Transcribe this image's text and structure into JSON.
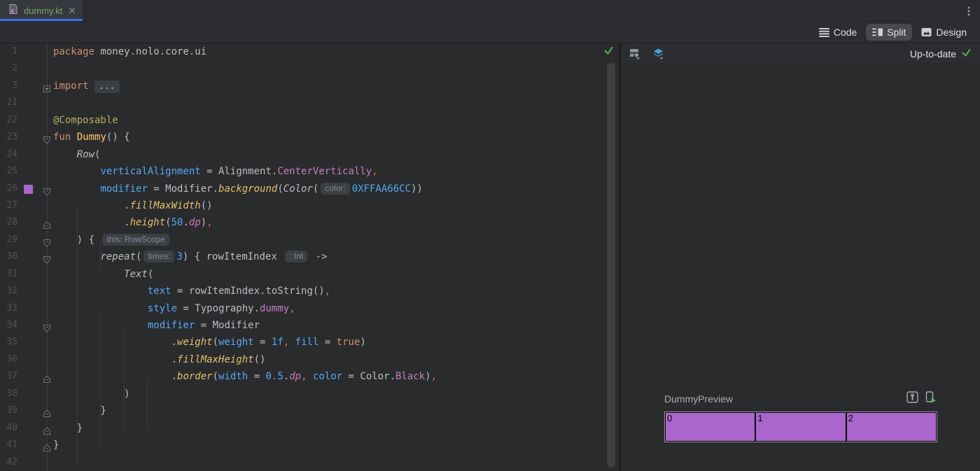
{
  "tab_bar": {
    "tab": {
      "label": "dummy.kt",
      "file_icon": "kotlin-file-icon",
      "close_icon": "close-icon",
      "active": true
    },
    "overflow_icon": "kebab-menu-icon"
  },
  "mode_toolbar": {
    "modes": [
      {
        "label": "Code",
        "icon": "code-lines-icon",
        "selected": false
      },
      {
        "label": "Split",
        "icon": "split-view-icon",
        "selected": true
      },
      {
        "label": "Design",
        "icon": "design-image-icon",
        "selected": false
      }
    ]
  },
  "editor": {
    "language": "kotlin",
    "token_colors": {
      "kw": "#CF8E6D",
      "ann": "#B3AE60",
      "decl": "#FFC66D",
      "w": "#BCBEC4",
      "calli": "#BCBEC4",
      "ext": "#E8BF6A",
      "param": "#56A8F5",
      "num": "#56A8F5",
      "prop": "#C77DBB",
      "propi": "#C77DBB",
      "comma": "#D5705C",
      "chip_text": "#868B94",
      "chip_bg": "#3C3F44",
      "foldbox_text": "#BFC2C7",
      "foldbox_bg": "#3B3E42"
    },
    "rows": [
      {
        "n": "1",
        "toks": [
          [
            "kw",
            "package"
          ],
          [
            "w",
            " money.nolo.core.ui"
          ]
        ]
      },
      {
        "n": "2",
        "toks": []
      },
      {
        "n": "3",
        "fold": "plus",
        "toks": [
          [
            "kw",
            "import"
          ],
          [
            "w",
            " "
          ],
          [
            "foldbox",
            "..."
          ]
        ]
      },
      {
        "n": "21",
        "toks": []
      },
      {
        "n": "22",
        "toks": [
          [
            "ann",
            "@Composable"
          ]
        ]
      },
      {
        "n": "23",
        "fold": "start",
        "toks": [
          [
            "kw",
            "fun"
          ],
          [
            "w",
            " "
          ],
          [
            "decl",
            "Dummy"
          ],
          [
            "w",
            "() {"
          ]
        ]
      },
      {
        "n": "24",
        "toks": [
          [
            "w",
            "    "
          ],
          [
            "calli",
            "Row"
          ],
          [
            "w",
            "("
          ]
        ]
      },
      {
        "n": "25",
        "toks": [
          [
            "w",
            "        "
          ],
          [
            "param",
            "verticalAlignment"
          ],
          [
            "w",
            " = Alignment."
          ],
          [
            "prop",
            "CenterVertically"
          ],
          [
            "comma",
            ","
          ]
        ]
      },
      {
        "n": "26",
        "fold": "start",
        "swatch": "#AA66CC",
        "toks": [
          [
            "w",
            "        "
          ],
          [
            "param",
            "modifier"
          ],
          [
            "w",
            " = Modifier."
          ],
          [
            "ext",
            "background"
          ],
          [
            "w",
            "("
          ],
          [
            "calli",
            "Color"
          ],
          [
            "w",
            "("
          ],
          [
            "chip",
            "color:"
          ],
          [
            "num",
            "0XFFAA66CC"
          ],
          [
            "w",
            "))"
          ]
        ]
      },
      {
        "n": "27",
        "toks": [
          [
            "w",
            "            ."
          ],
          [
            "ext",
            "fillMaxWidth"
          ],
          [
            "w",
            "()"
          ]
        ]
      },
      {
        "n": "28",
        "fold": "end",
        "toks": [
          [
            "w",
            "            ."
          ],
          [
            "ext",
            "height"
          ],
          [
            "w",
            "("
          ],
          [
            "num",
            "50"
          ],
          [
            "w",
            "."
          ],
          [
            "propi",
            "dp"
          ],
          [
            "w",
            ")"
          ],
          [
            "comma",
            ","
          ]
        ]
      },
      {
        "n": "29",
        "fold": "start",
        "toks": [
          [
            "w",
            "    ) { "
          ],
          [
            "chip",
            "this: RowScope"
          ]
        ]
      },
      {
        "n": "30",
        "fold": "start",
        "toks": [
          [
            "w",
            "        "
          ],
          [
            "calli",
            "repeat"
          ],
          [
            "w",
            "("
          ],
          [
            "chip",
            "times:"
          ],
          [
            "num",
            "3"
          ],
          [
            "w",
            ") { rowItemIndex "
          ],
          [
            "chip",
            ": Int"
          ],
          [
            "w",
            " ->"
          ]
        ]
      },
      {
        "n": "31",
        "toks": [
          [
            "w",
            "            "
          ],
          [
            "calli",
            "Text"
          ],
          [
            "w",
            "("
          ]
        ]
      },
      {
        "n": "32",
        "toks": [
          [
            "w",
            "                "
          ],
          [
            "param",
            "text"
          ],
          [
            "w",
            " = rowItemIndex.toString()"
          ],
          [
            "comma",
            ","
          ]
        ]
      },
      {
        "n": "33",
        "toks": [
          [
            "w",
            "                "
          ],
          [
            "param",
            "style"
          ],
          [
            "w",
            " = Typography."
          ],
          [
            "prop",
            "dummy"
          ],
          [
            "comma",
            ","
          ]
        ]
      },
      {
        "n": "34",
        "fold": "start",
        "toks": [
          [
            "w",
            "                "
          ],
          [
            "param",
            "modifier"
          ],
          [
            "w",
            " = Modifier"
          ]
        ]
      },
      {
        "n": "35",
        "toks": [
          [
            "w",
            "                    ."
          ],
          [
            "ext",
            "weight"
          ],
          [
            "w",
            "("
          ],
          [
            "param",
            "weight"
          ],
          [
            "w",
            " = "
          ],
          [
            "num",
            "1f"
          ],
          [
            "comma",
            ","
          ],
          [
            "w",
            " "
          ],
          [
            "param",
            "fill"
          ],
          [
            "w",
            " = "
          ],
          [
            "kw",
            "true"
          ],
          [
            "w",
            ")"
          ]
        ]
      },
      {
        "n": "36",
        "toks": [
          [
            "w",
            "                    ."
          ],
          [
            "ext",
            "fillMaxHeight"
          ],
          [
            "w",
            "()"
          ]
        ]
      },
      {
        "n": "37",
        "fold": "end",
        "toks": [
          [
            "w",
            "                    ."
          ],
          [
            "ext",
            "border"
          ],
          [
            "w",
            "("
          ],
          [
            "param",
            "width"
          ],
          [
            "w",
            " = "
          ],
          [
            "num",
            "0.5"
          ],
          [
            "w",
            "."
          ],
          [
            "propi",
            "dp"
          ],
          [
            "comma",
            ","
          ],
          [
            "w",
            " "
          ],
          [
            "param",
            "color"
          ],
          [
            "w",
            " = Color."
          ],
          [
            "prop",
            "Black"
          ],
          [
            "w",
            ")"
          ],
          [
            "comma",
            ","
          ]
        ]
      },
      {
        "n": "38",
        "toks": [
          [
            "w",
            "            )"
          ]
        ]
      },
      {
        "n": "39",
        "fold": "end",
        "toks": [
          [
            "w",
            "        }"
          ]
        ]
      },
      {
        "n": "40",
        "fold": "end",
        "toks": [
          [
            "w",
            "    }"
          ]
        ]
      },
      {
        "n": "41",
        "fold": "end",
        "toks": [
          [
            "w",
            "}"
          ]
        ]
      },
      {
        "n": "42",
        "toks": []
      }
    ],
    "inspections_status_icon": "inspections-ok-icon"
  },
  "preview_panel": {
    "toolbar": {
      "status": "Up-to-date",
      "status_icon": "check-icon",
      "icons": [
        "ui-mode-icon",
        "layers-icon"
      ]
    },
    "preview": {
      "name": "DummyPreview",
      "cells": [
        "0",
        "1",
        "2"
      ],
      "cell_color": "#AA66CC",
      "icons": [
        "interactive-preview-icon",
        "run-on-device-icon"
      ]
    }
  }
}
